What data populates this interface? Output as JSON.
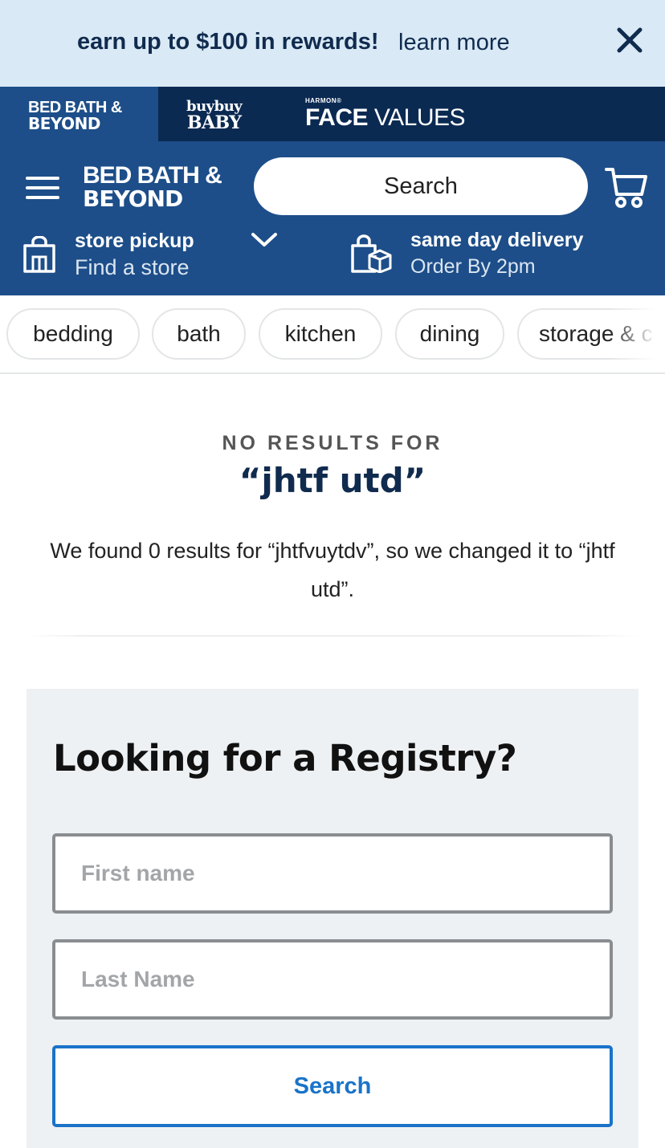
{
  "promo": {
    "text": "earn up to $100 in rewards!",
    "link": "learn more",
    "close_icon": "close-icon"
  },
  "brands": {
    "bbb": {
      "line1": "BED BATH &",
      "line2": "BEYOND"
    },
    "baby": {
      "line1": "buybuy",
      "line2": "BABY"
    },
    "face_values": {
      "line1": "HARMON®",
      "line2a": "FACE",
      "line2b": " VALUES"
    }
  },
  "header": {
    "logo": {
      "line1": "BED BATH &",
      "line2": "BEYOND"
    },
    "search_placeholder": "Search",
    "menu_icon": "hamburger-menu-icon",
    "cart_icon": "cart-icon"
  },
  "pickup": {
    "title": "store pickup",
    "subtitle": "Find a store",
    "icon": "shopping-bag-icon"
  },
  "delivery": {
    "title": "same day delivery",
    "subtitle": "Order By 2pm",
    "icon": "box-bag-icon"
  },
  "categories": [
    "bedding",
    "bath",
    "kitchen",
    "dining",
    "storage & c"
  ],
  "no_results": {
    "label": "NO RESULTS FOR",
    "term": "“jhtf utd”",
    "description": "We found 0 results for “jhtfvuytdv”, so we changed it to “jhtf utd”."
  },
  "registry": {
    "title": "Looking for a Registry?",
    "first_name_placeholder": "First name",
    "last_name_placeholder": "Last Name",
    "search_label": "Search"
  },
  "colors": {
    "promo_bg": "#d9e9f5",
    "brandbar_bg": "#0b2a52",
    "header_bg": "#1d4e89",
    "accent": "#1a73c8",
    "navy_text": "#102b4e"
  }
}
